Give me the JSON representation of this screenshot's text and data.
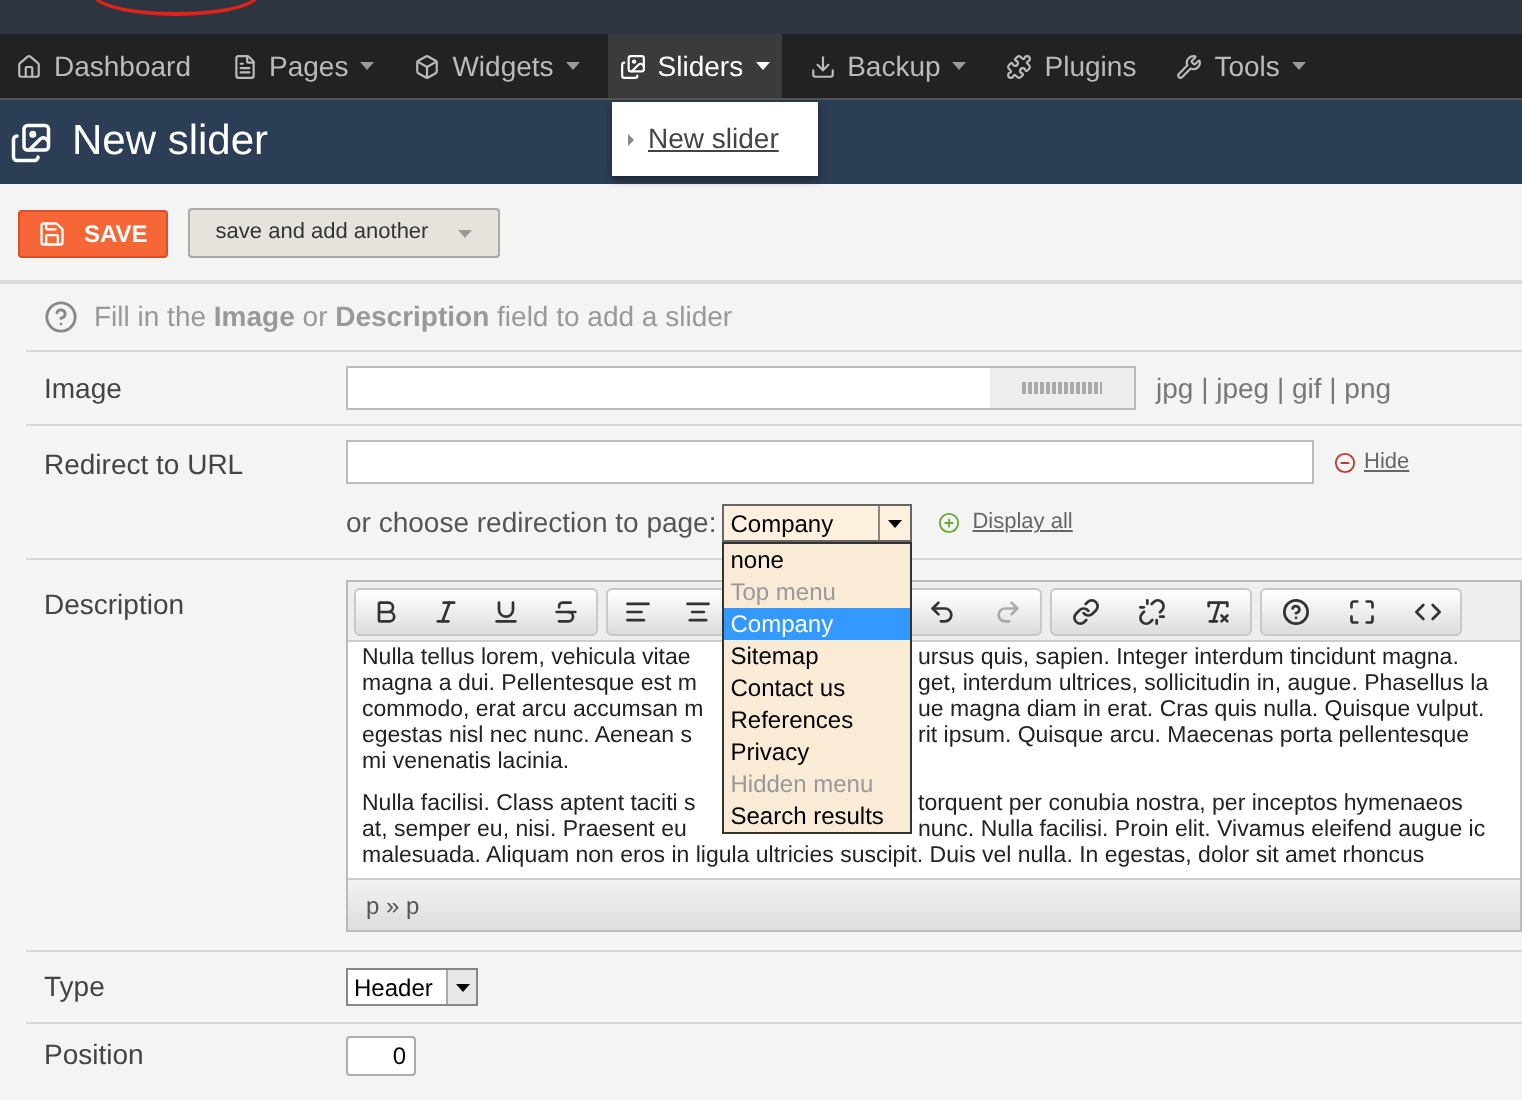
{
  "nav": [
    {
      "label": "Dashboard",
      "has_menu": false,
      "selected": false
    },
    {
      "label": "Pages",
      "has_menu": true,
      "selected": false
    },
    {
      "label": "Widgets",
      "has_menu": true,
      "selected": false
    },
    {
      "label": "Sliders",
      "has_menu": true,
      "selected": true
    },
    {
      "label": "Backup",
      "has_menu": true,
      "selected": false
    },
    {
      "label": "Plugins",
      "has_menu": false,
      "selected": false
    },
    {
      "label": "Tools",
      "has_menu": true,
      "selected": false
    }
  ],
  "nav_menu": {
    "items": [
      "New slider"
    ]
  },
  "page_title": "New slider",
  "actions": {
    "save": "SAVE",
    "save_another": "save and add another"
  },
  "hint": "Fill in the **Image** or **Description** field to add a slider",
  "image": {
    "label": "Image",
    "formats": "jpg | jpeg | gif | png"
  },
  "redirect": {
    "label": "Redirect to URL",
    "hide": "Hide",
    "choose_label": "or choose redirection to page:",
    "selected_value": "Company",
    "display_all": "Display all",
    "options": [
      {
        "label": "none",
        "disabled": false,
        "selected": false
      },
      {
        "label": "Top menu",
        "disabled": true,
        "selected": false
      },
      {
        "label": "Company",
        "disabled": false,
        "selected": true
      },
      {
        "label": "Sitemap",
        "disabled": false,
        "selected": false
      },
      {
        "label": "Contact us",
        "disabled": false,
        "selected": false
      },
      {
        "label": "References",
        "disabled": false,
        "selected": false
      },
      {
        "label": "Privacy",
        "disabled": false,
        "selected": false
      },
      {
        "label": "Hidden menu",
        "disabled": true,
        "selected": false
      },
      {
        "label": "Search results",
        "disabled": false,
        "selected": false
      }
    ]
  },
  "description": {
    "label": "Description",
    "paragraphs": [
      [
        {
          "left": "Nulla tellus lorem, vehicula vitae",
          "right": "ursus quis, sapien. Integer interdum tincidunt magna."
        },
        {
          "left": "magna a dui. Pellentesque est m",
          "right": "get, interdum ultrices, sollicitudin in, augue. Phasellus la"
        },
        {
          "left": "commodo, erat arcu accumsan m",
          "right": "ue magna diam in erat. Cras quis nulla. Quisque vulput."
        },
        {
          "left": "egestas nisl nec nunc. Aenean s",
          "right": "rit ipsum. Quisque arcu. Maecenas porta pellentesque"
        },
        {
          "left": "mi venenatis lacinia."
        }
      ],
      [
        {
          "left": "Nulla facilisi. Class aptent taciti s",
          "right": "torquent per conubia nostra, per inceptos hymenaeos"
        },
        {
          "left": "at, semper eu, nisi. Praesent eu",
          "right": "nunc. Nulla facilisi. Proin elit. Vivamus eleifend augue ic"
        },
        {
          "left": "malesuada. Aliquam non eros in ligula ultricies suscipit. Duis vel nulla. In egestas, dolor sit amet rhoncus"
        }
      ]
    ],
    "path": "p » p"
  },
  "type": {
    "label": "Type",
    "value": "Header"
  },
  "position": {
    "label": "Position",
    "value": "0"
  }
}
